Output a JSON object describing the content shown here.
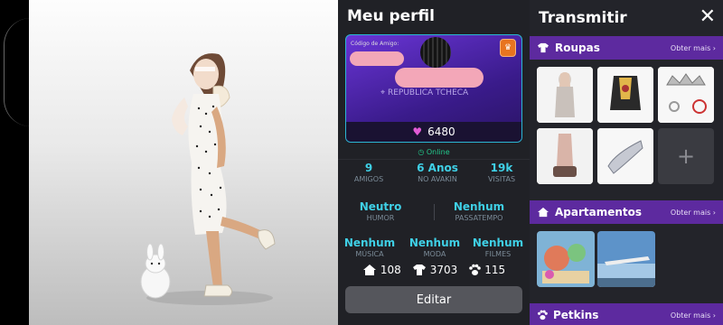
{
  "profile": {
    "title": "Meu perfil",
    "card": {
      "friend_code_label": "Código de Amigo:",
      "location": "REPUBLICA TCHECA",
      "hearts": "6480"
    },
    "status": "Online",
    "stats_row1": [
      {
        "value": "9",
        "label": "AMIGOS"
      },
      {
        "value": "6 Anos",
        "label": "NO AVAKIN"
      },
      {
        "value": "19k",
        "label": "VISITAS"
      }
    ],
    "stats_row2": [
      {
        "value": "Neutro",
        "label": "HUMOR"
      },
      {
        "value": "Nenhum",
        "label": "PASSATEMPO"
      }
    ],
    "stats_row3": [
      {
        "value": "Nenhum",
        "label": "MÚSICA"
      },
      {
        "value": "Nenhum",
        "label": "MODA"
      },
      {
        "value": "Nenhum",
        "label": "FILMES"
      }
    ],
    "counts": {
      "houses": "108",
      "clothes": "3703",
      "pets": "115"
    },
    "edit_label": "Editar"
  },
  "store": {
    "title": "Transmitir",
    "more_label": "Obter mais ›",
    "sections": {
      "clothes": "Roupas",
      "apartments": "Apartamentos",
      "pets": "Petkins"
    }
  },
  "colors": {
    "accent": "#5d2a9f",
    "cyan": "#3fd0e6",
    "online": "#22c98b",
    "heart": "#e25bd6"
  },
  "icons": [
    "close-icon",
    "shirt-icon",
    "house-icon",
    "paw-icon",
    "heart-icon",
    "location-icon",
    "add-icon"
  ]
}
